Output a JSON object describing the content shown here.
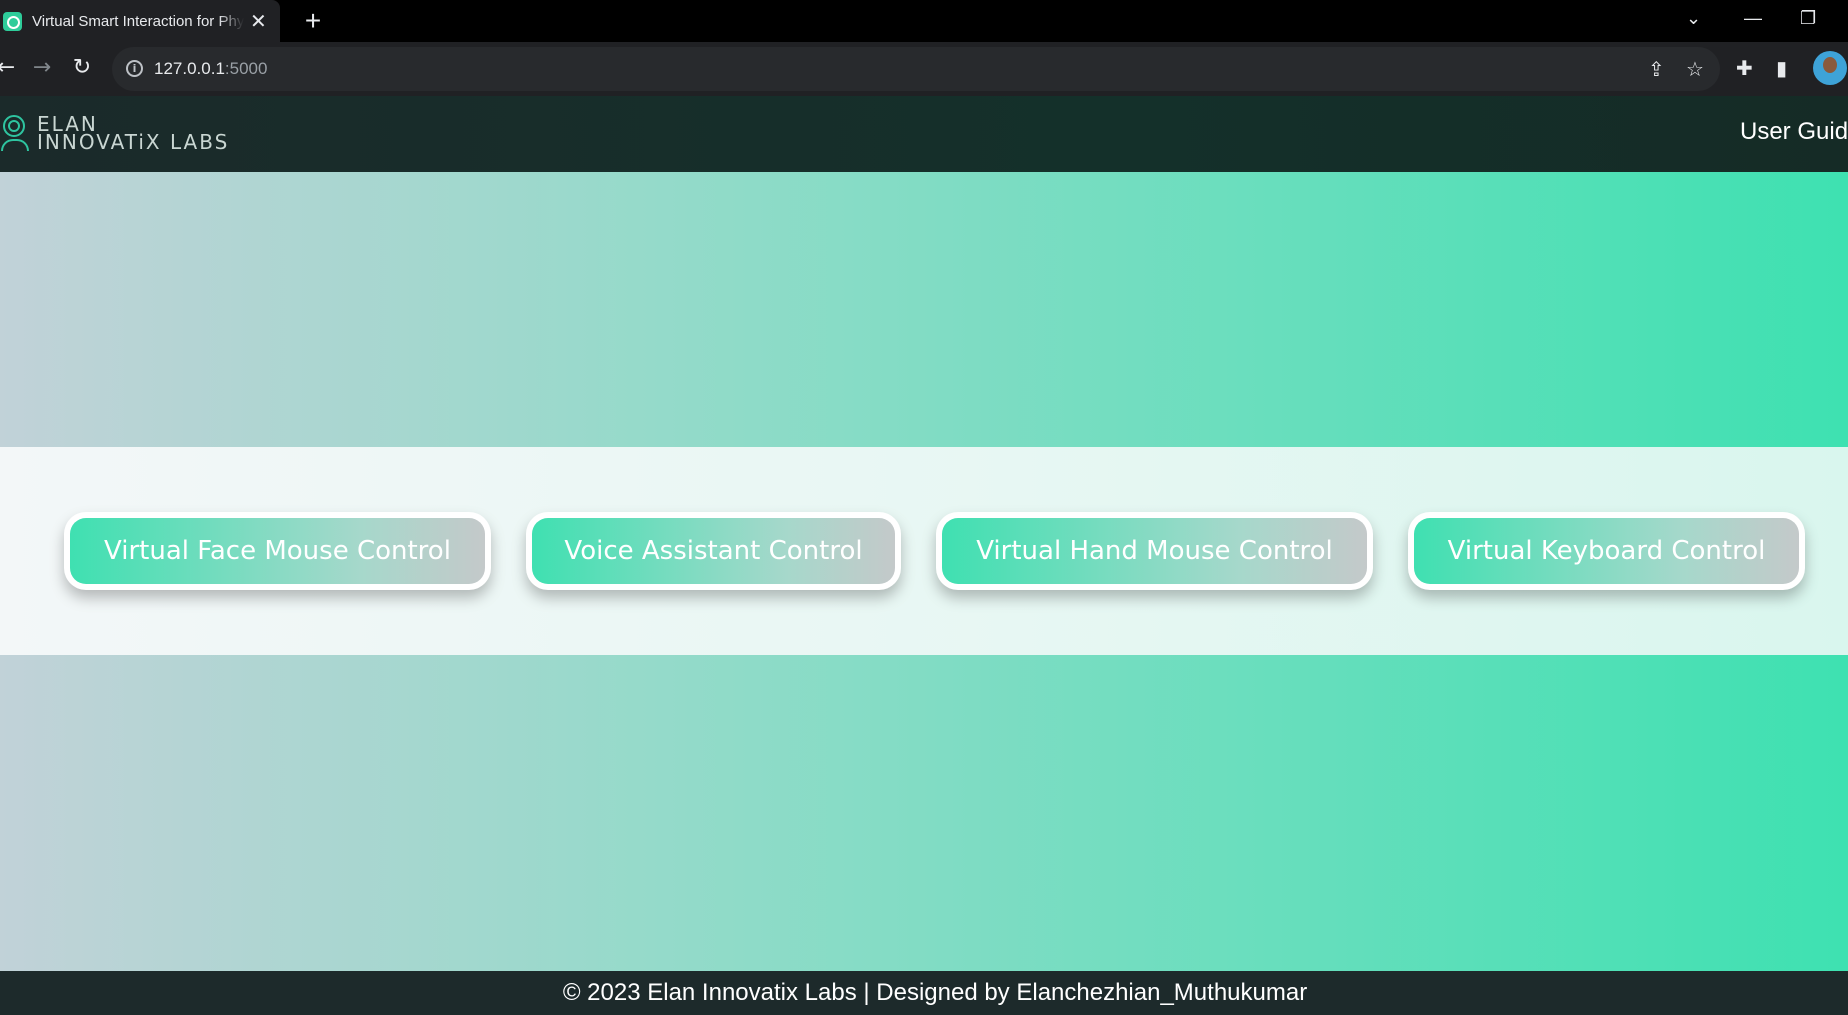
{
  "browser": {
    "tab_title": "Virtual Smart Interaction for Physically Challenged",
    "new_tab": "+",
    "close": "✕",
    "url_host": "127.0.0.1",
    "url_port": ":5000"
  },
  "navbar": {
    "logo_line1": "ELAN",
    "logo_line2": "INNOVATiX LABS",
    "user_guide": "User Guide"
  },
  "controls": [
    {
      "label": "Virtual Face Mouse Control"
    },
    {
      "label": "Voice Assistant Control"
    },
    {
      "label": "Virtual Hand Mouse Control"
    },
    {
      "label": "Virtual Keyboard Control"
    }
  ],
  "footer": {
    "text": "© 2023 Elan Innovatix Labs | Designed by Elanchezhian_Muthukumar"
  },
  "colors": {
    "accent": "#3ee1b1",
    "navbar": "#1b2a2a",
    "footer": "#1d2a2b"
  }
}
